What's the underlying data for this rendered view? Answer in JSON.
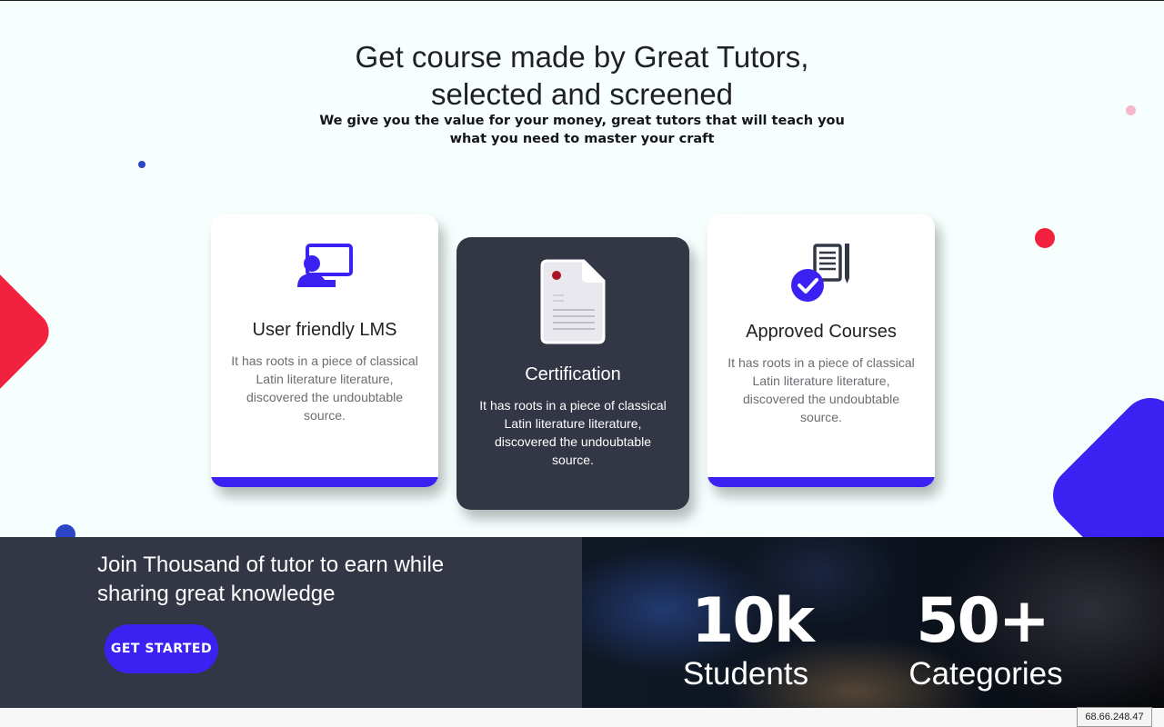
{
  "hero": {
    "title": "Get course made by Great Tutors, selected and screened",
    "subtitle": "We give you the value for your money, great tutors that will teach you what you need to master your craft"
  },
  "features": [
    {
      "title": "User friendly LMS",
      "description": "It has roots in a piece of classical Latin literature literature, discovered the undoubtable source.",
      "icon": "presentation-user-icon"
    },
    {
      "title": "Certification",
      "description": "It has roots in a piece of classical Latin literature literature, discovered the undoubtable source.",
      "icon": "certificate-document-icon"
    },
    {
      "title": "Approved Courses",
      "description": "It has roots in a piece of classical Latin literature literature, discovered the undoubtable source.",
      "icon": "approved-checklist-icon"
    }
  ],
  "banner": {
    "title": "Join Thousand of tutor to earn while sharing great knowledge",
    "cta_label": "GET STARTED"
  },
  "stats": [
    {
      "value": "10k",
      "label": "Students"
    },
    {
      "value": "50+",
      "label": "Categories"
    }
  ],
  "ip_address": "68.66.248.47",
  "colors": {
    "accent": "#3c22f2",
    "dark_panel": "#333645",
    "decor_red": "#f2223e",
    "decor_blue": "#2b46c7",
    "decor_pink": "#f7b8cd",
    "page_background": "#f6fffe"
  }
}
